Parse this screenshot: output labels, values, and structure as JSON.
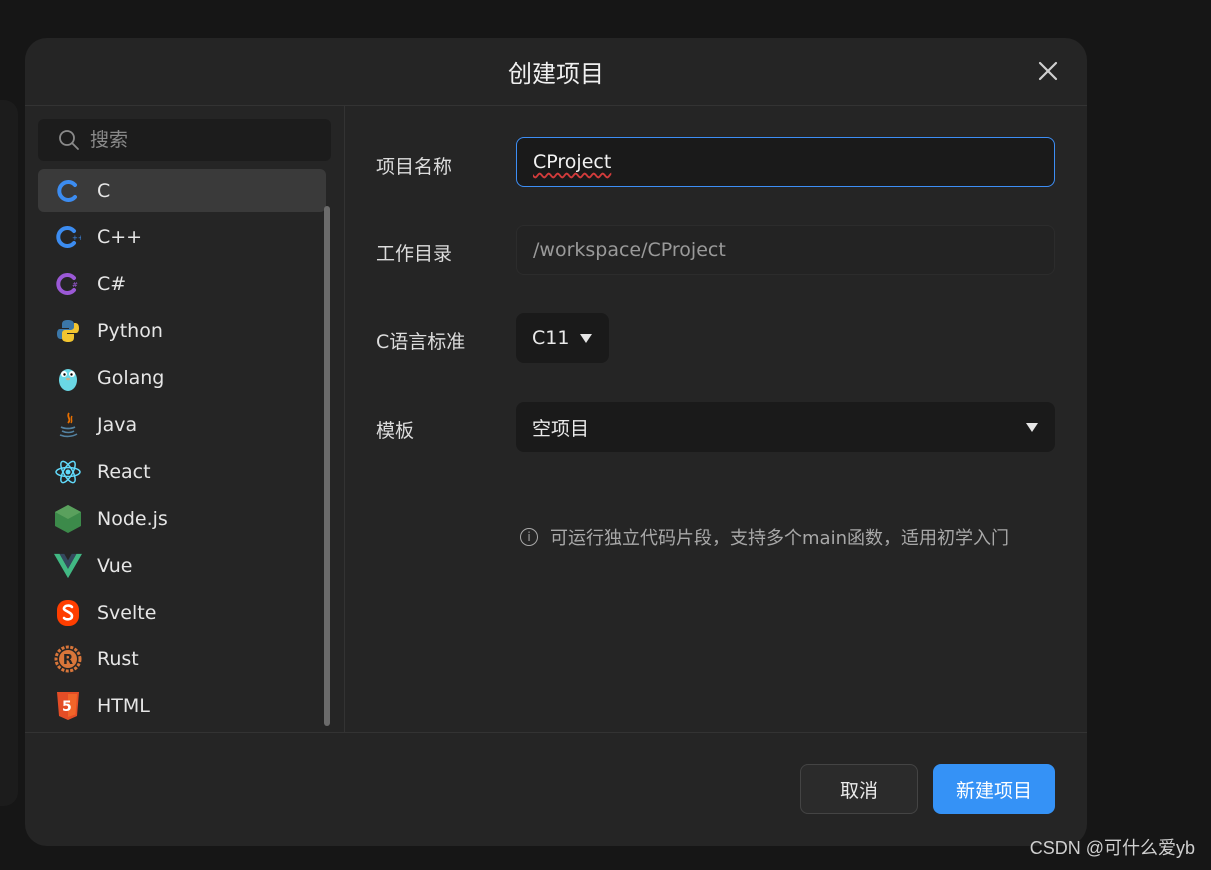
{
  "dialog": {
    "title": "创建项目"
  },
  "search": {
    "placeholder": "搜索"
  },
  "languages": [
    {
      "label": "C"
    },
    {
      "label": "C++"
    },
    {
      "label": "C#"
    },
    {
      "label": "Python"
    },
    {
      "label": "Golang"
    },
    {
      "label": "Java"
    },
    {
      "label": "React"
    },
    {
      "label": "Node.js"
    },
    {
      "label": "Vue"
    },
    {
      "label": "Svelte"
    },
    {
      "label": "Rust"
    },
    {
      "label": "HTML"
    }
  ],
  "selected_language": "C",
  "form": {
    "name_label": "项目名称",
    "name_value": "CProject",
    "dir_label": "工作目录",
    "dir_value": "/workspace/CProject",
    "std_label": "C语言标准",
    "std_value": "C11",
    "template_label": "模板",
    "template_value": "空项目",
    "hint": "可运行独立代码片段，支持多个main函数，适用初学入门"
  },
  "footer": {
    "cancel_label": "取消",
    "create_label": "新建项目"
  },
  "watermark": "CSDN @可什么爱yb",
  "colors": {
    "accent": "#3592f6",
    "background": "#252525"
  }
}
